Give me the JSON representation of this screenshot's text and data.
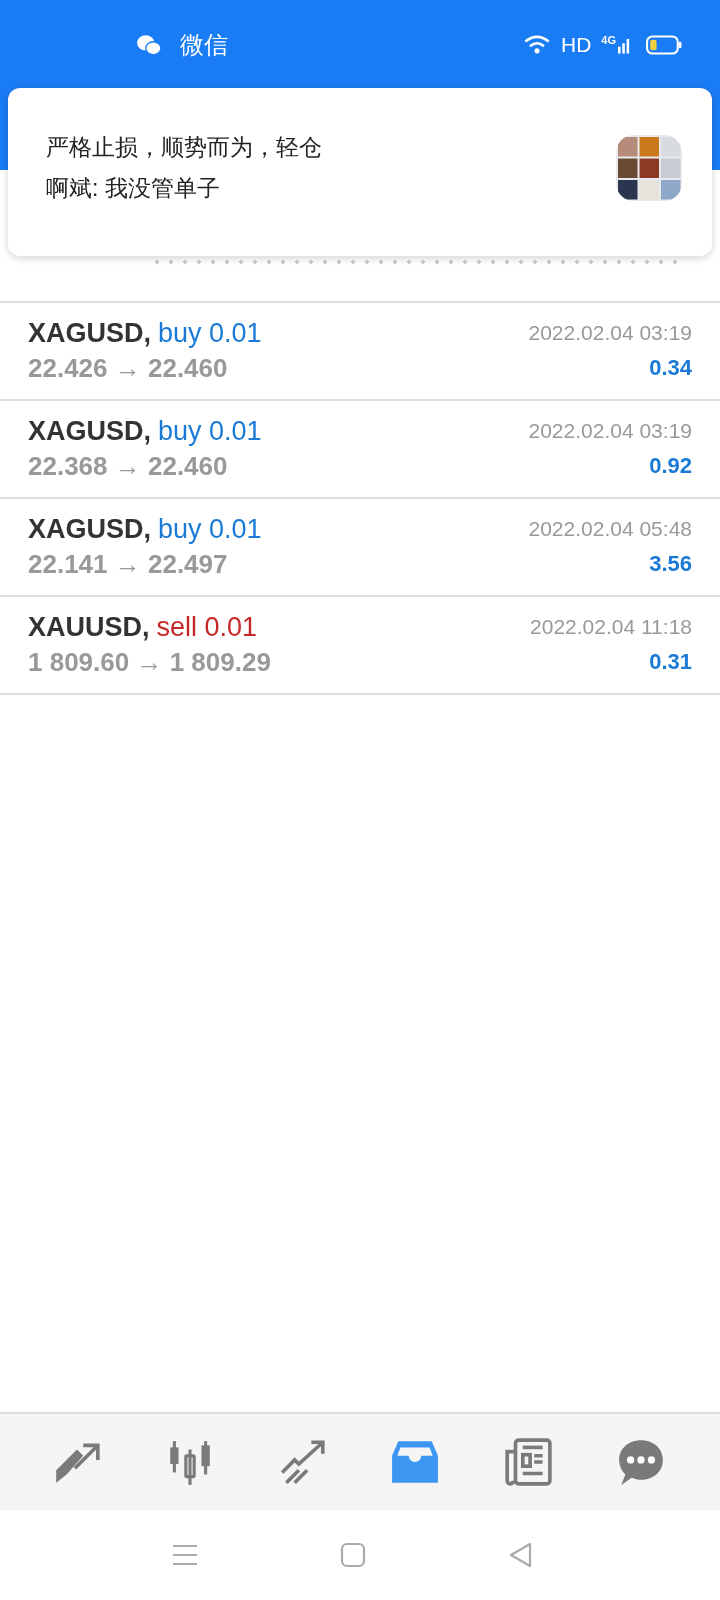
{
  "status_bar": {
    "app_label": "微信",
    "network": "HD",
    "signal": "4G"
  },
  "notification": {
    "title": "严格止损，顺势而为，轻仓",
    "message": "啊斌: 我没管单子"
  },
  "trades": [
    {
      "symbol": "XAGUSD,",
      "kind": "buy",
      "order": "buy 0.01",
      "prices": "22.426 → 22.460",
      "time": "2022.02.04 03:19",
      "profit": "0.34"
    },
    {
      "symbol": "XAGUSD,",
      "kind": "buy",
      "order": "buy 0.01",
      "prices": "22.368 → 22.460",
      "time": "2022.02.04 03:19",
      "profit": "0.92"
    },
    {
      "symbol": "XAGUSD,",
      "kind": "buy",
      "order": "buy 0.01",
      "prices": "22.141 → 22.497",
      "time": "2022.02.04 05:48",
      "profit": "3.56"
    },
    {
      "symbol": "XAUUSD,",
      "kind": "sell",
      "order": "sell 0.01",
      "prices": "1 809.60 → 1 809.29",
      "time": "2022.02.04 11:18",
      "profit": "0.31"
    }
  ],
  "tab_bar": [
    {
      "kind": "quotes",
      "selected": false
    },
    {
      "kind": "chart",
      "selected": false
    },
    {
      "kind": "trade",
      "selected": false
    },
    {
      "kind": "history",
      "selected": true
    },
    {
      "kind": "news",
      "selected": false
    },
    {
      "kind": "chat",
      "selected": false
    }
  ],
  "system_nav": [
    {
      "kind": "menu"
    },
    {
      "kind": "home"
    },
    {
      "kind": "back"
    }
  ]
}
